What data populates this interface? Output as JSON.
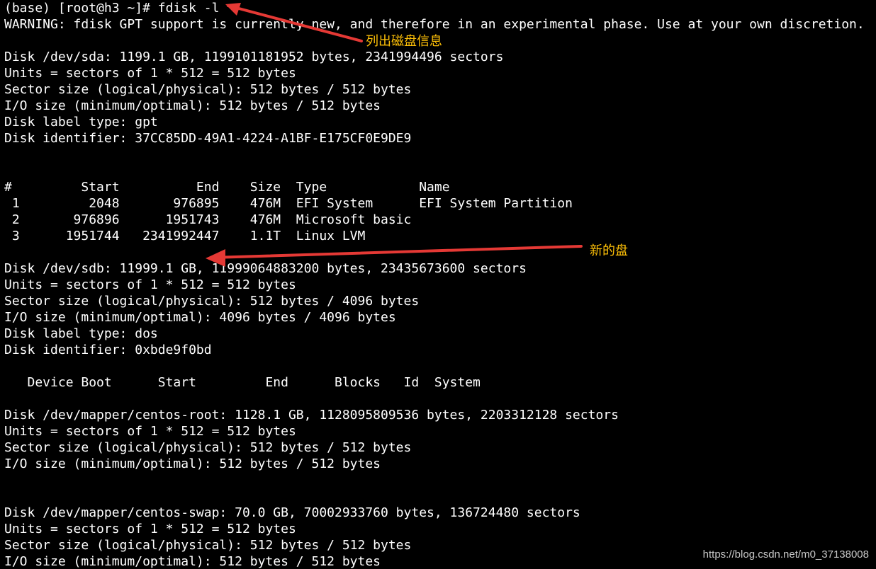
{
  "terminal": {
    "background": "#000000",
    "text_color": "#ffffff",
    "lines": [
      "(base) [root@h3 ~]# fdisk -l",
      "WARNING: fdisk GPT support is currently new, and therefore in an experimental phase. Use at your own discretion.",
      "",
      "Disk /dev/sda: 1199.1 GB, 1199101181952 bytes, 2341994496 sectors",
      "Units = sectors of 1 * 512 = 512 bytes",
      "Sector size (logical/physical): 512 bytes / 512 bytes",
      "I/O size (minimum/optimal): 512 bytes / 512 bytes",
      "Disk label type: gpt",
      "Disk identifier: 37CC85DD-49A1-4224-A1BF-E175CF0E9DE9",
      "",
      "",
      "#         Start          End    Size  Type            Name",
      " 1         2048       976895    476M  EFI System      EFI System Partition",
      " 2       976896      1951743    476M  Microsoft basic",
      " 3      1951744   2341992447    1.1T  Linux LVM",
      "",
      "Disk /dev/sdb: 11999.1 GB, 11999064883200 bytes, 23435673600 sectors",
      "Units = sectors of 1 * 512 = 512 bytes",
      "Sector size (logical/physical): 512 bytes / 4096 bytes",
      "I/O size (minimum/optimal): 4096 bytes / 4096 bytes",
      "Disk label type: dos",
      "Disk identifier: 0xbde9f0bd",
      "",
      "   Device Boot      Start         End      Blocks   Id  System",
      "",
      "Disk /dev/mapper/centos-root: 1128.1 GB, 1128095809536 bytes, 2203312128 sectors",
      "Units = sectors of 1 * 512 = 512 bytes",
      "Sector size (logical/physical): 512 bytes / 512 bytes",
      "I/O size (minimum/optimal): 512 bytes / 512 bytes",
      "",
      "",
      "Disk /dev/mapper/centos-swap: 70.0 GB, 70002933760 bytes, 136724480 sectors",
      "Units = sectors of 1 * 512 = 512 bytes",
      "Sector size (logical/physical): 512 bytes / 512 bytes",
      "I/O size (minimum/optimal): 512 bytes / 512 bytes"
    ]
  },
  "annotations": {
    "color": "#ffc107",
    "arrow_color": "#e53935",
    "list_disks": "列出磁盘信息",
    "new_disk": "新的盘"
  },
  "watermark": {
    "text": "https://blog.csdn.net/m0_37138008"
  }
}
